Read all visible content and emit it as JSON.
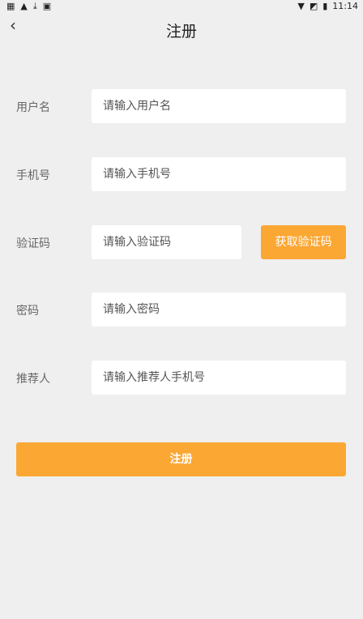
{
  "status_bar": {
    "time": "11:14",
    "left_icons": [
      "sim-icon",
      "warning-icon",
      "download-icon",
      "app-icon"
    ],
    "right_icons": [
      "wifi-icon",
      "no-sim-icon",
      "battery-icon"
    ]
  },
  "header": {
    "back_glyph": "‹",
    "title": "注册"
  },
  "form": {
    "username": {
      "label": "用户名",
      "placeholder": "请输入用户名"
    },
    "phone": {
      "label": "手机号",
      "placeholder": "请输入手机号"
    },
    "code": {
      "label": "验证码",
      "placeholder": "请输入验证码",
      "button": "获取验证码"
    },
    "password": {
      "label": "密码",
      "placeholder": "请输入密码"
    },
    "referrer": {
      "label": "推荐人",
      "placeholder": "请输入推荐人手机号"
    }
  },
  "submit": {
    "label": "注册"
  },
  "colors": {
    "accent": "#fba734",
    "background": "#efefef",
    "input_bg": "#ffffff"
  }
}
